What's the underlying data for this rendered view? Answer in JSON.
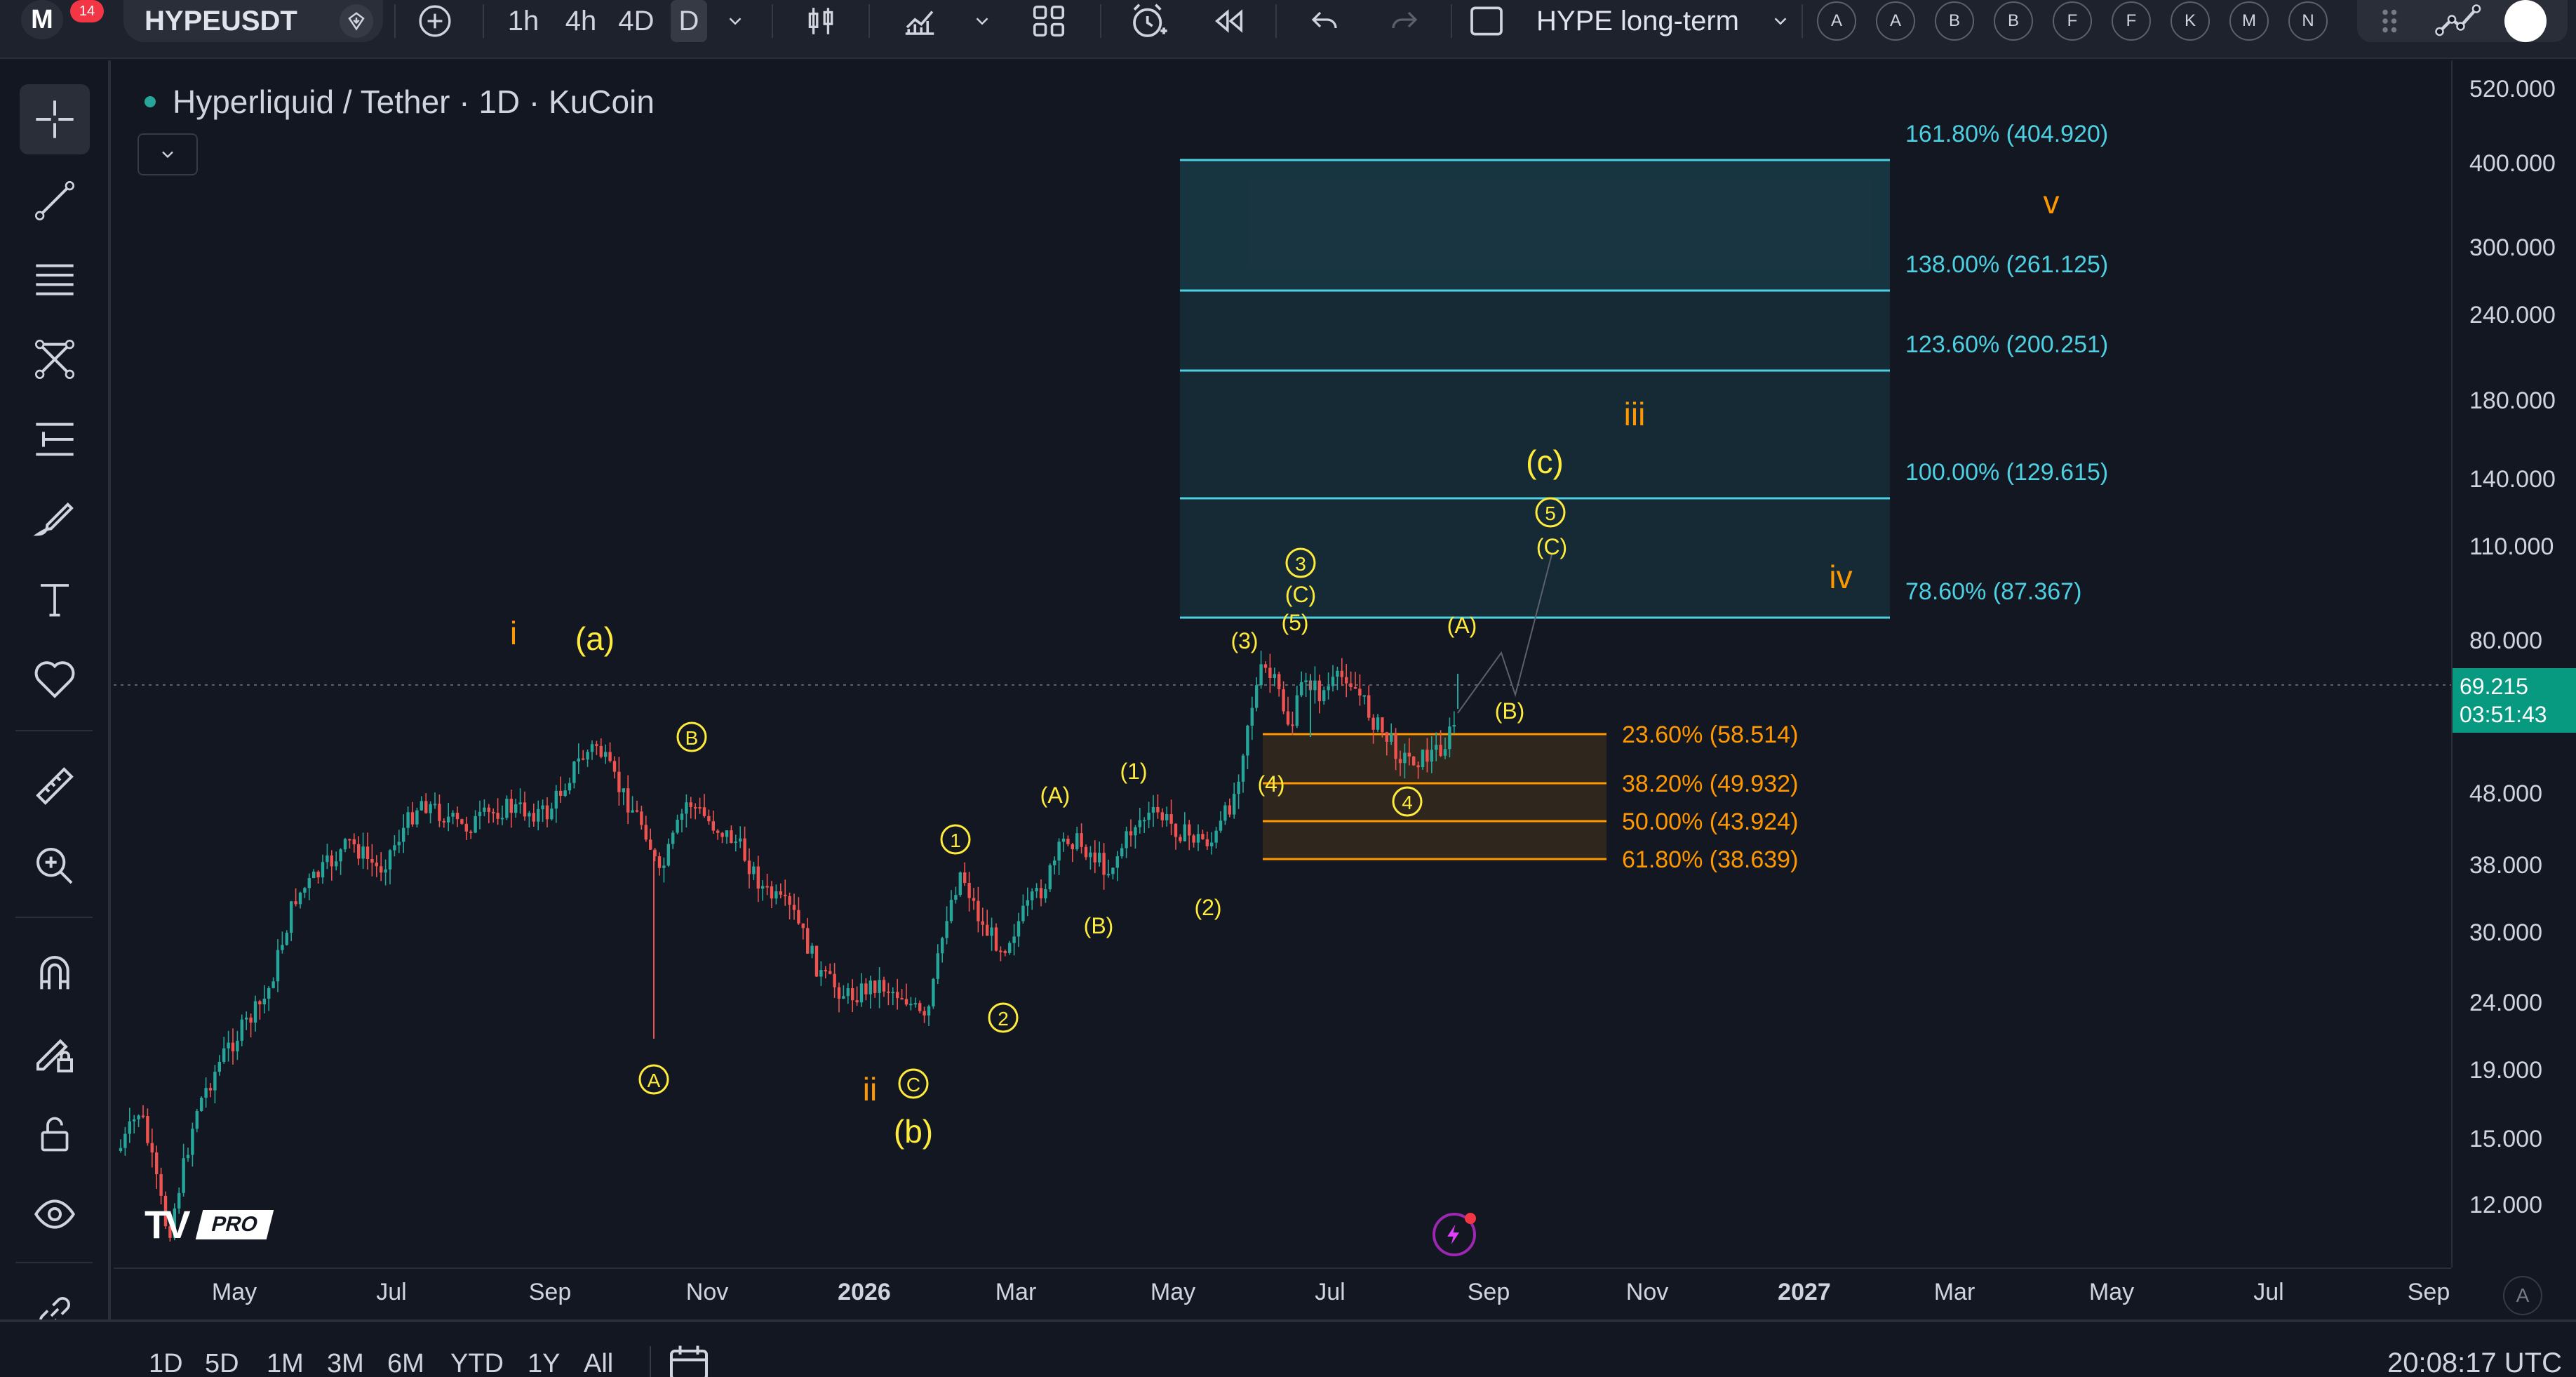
{
  "topbar": {
    "notification_count": "14",
    "symbol": "HYPEUSDT",
    "intervals": [
      "1h",
      "4h",
      "4D",
      "D"
    ],
    "active_interval": "D",
    "layout_name": "HYPE long-term",
    "alert_circles": [
      "A",
      "A",
      "B",
      "B",
      "F",
      "F",
      "K",
      "M",
      "N"
    ]
  },
  "chart": {
    "title": "Hyperliquid / Tether · 1D · KuCoin"
  },
  "price_axis": {
    "ticks": [
      "520.000",
      "400.000",
      "300.000",
      "240.000",
      "180.000",
      "140.000",
      "110.000",
      "80.000",
      "48.000",
      "38.000",
      "30.000",
      "24.000",
      "19.000",
      "15.000",
      "12.000"
    ],
    "current_price": "69.215",
    "countdown": "03:51:43"
  },
  "time_axis": {
    "ticks": [
      "May",
      "Jul",
      "Sep",
      "Nov",
      "2026",
      "Mar",
      "May",
      "Jul",
      "Sep",
      "Nov",
      "2027",
      "Mar",
      "May",
      "Jul",
      "Sep"
    ],
    "auto_label": "A"
  },
  "bottombar": {
    "ranges": [
      "1D",
      "5D",
      "1M",
      "3M",
      "6M",
      "YTD",
      "1Y",
      "All"
    ],
    "clock": "20:08:17 UTC"
  },
  "fib_extension": [
    {
      "label": "161.80% (404.920)"
    },
    {
      "label": "138.00% (261.125)"
    },
    {
      "label": "123.60% (200.251)"
    },
    {
      "label": "100.00% (129.615)"
    },
    {
      "label": "78.60% (87.367)"
    }
  ],
  "fib_retracement": [
    {
      "label": "23.60% (58.514)"
    },
    {
      "label": "38.20% (49.932)"
    },
    {
      "label": "50.00% (43.924)"
    },
    {
      "label": "61.80% (38.639)"
    }
  ],
  "wave_labels": {
    "orange": [
      "i",
      "ii",
      "iii",
      "iv",
      "v"
    ],
    "yellow_large": [
      "(a)",
      "(b)",
      "(c)"
    ],
    "yellow_small": [
      "(1)",
      "(2)",
      "(3)",
      "(4)",
      "(5)",
      "(A)",
      "(B)",
      "(C)",
      "(A)",
      "(B)",
      "(C)"
    ],
    "circled": [
      "A",
      "B",
      "C",
      "1",
      "2",
      "3",
      "4",
      "5"
    ]
  },
  "tv_logo": {
    "badge": "PRO"
  },
  "colors": {
    "background": "#131722",
    "up_candle": "#26a69a",
    "down_candle": "#ef5350",
    "fib_extension": "#4dd0e1",
    "fib_retracement": "#ff9800",
    "wave_yellow": "#ffeb3b",
    "wave_orange": "#ff9800",
    "price_label": "#089981"
  }
}
